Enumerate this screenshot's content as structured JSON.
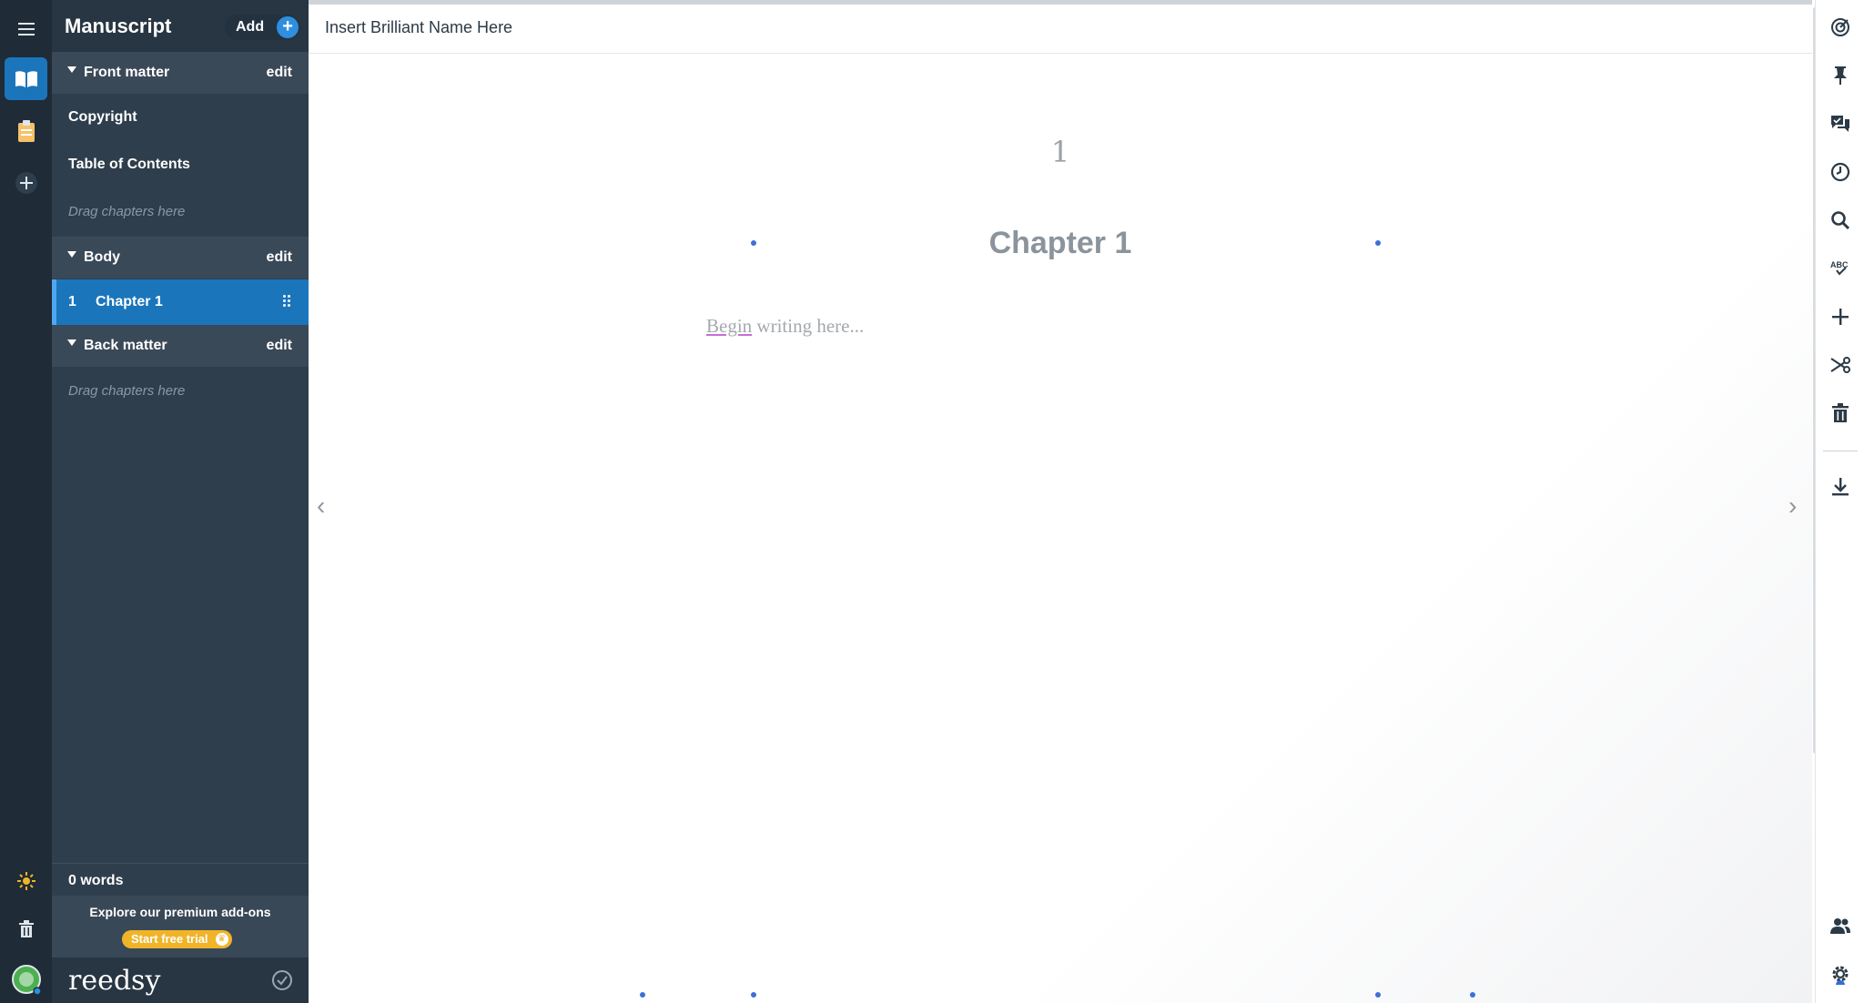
{
  "rail": {
    "items": [
      {
        "name": "menu-icon"
      },
      {
        "name": "book-icon",
        "active": true
      },
      {
        "name": "clipboard-icon"
      },
      {
        "name": "plus-circle-icon"
      }
    ],
    "bottom": [
      "sun-icon",
      "trash-icon",
      "avatar"
    ]
  },
  "sidebar": {
    "title": "Manuscript",
    "add_label": "Add",
    "front_matter": {
      "label": "Front matter",
      "edit": "edit",
      "items": [
        "Copyright",
        "Table of Contents"
      ],
      "drag_hint": "Drag chapters here"
    },
    "body": {
      "label": "Body",
      "edit": "edit",
      "chapter": {
        "number": "1",
        "label": "Chapter 1"
      }
    },
    "back_matter": {
      "label": "Back matter",
      "edit": "edit",
      "drag_hint": "Drag chapters here"
    },
    "word_count": "0 words",
    "promo_text": "Explore our premium add-ons",
    "trial_label": "Start free trial",
    "brand": "reedsy"
  },
  "editor": {
    "book_title": "Insert Brilliant Name Here",
    "chapter_number": "1",
    "chapter_title": "Chapter 1",
    "placeholder_first": "Begin",
    "placeholder_rest": " writing here..."
  },
  "toolbar": {
    "icons": [
      "goal-icon",
      "pin-icon",
      "comments-icon",
      "history-icon",
      "search-icon",
      "spellcheck-icon",
      "add-icon",
      "scissors-icon",
      "trash-icon",
      "download-icon",
      "collaborators-icon",
      "settings-icon"
    ]
  },
  "colors": {
    "rail": "#1f2b36",
    "sidebar": "#2f3e4c",
    "accent": "#1b75bb",
    "trial": "#f0b429"
  }
}
